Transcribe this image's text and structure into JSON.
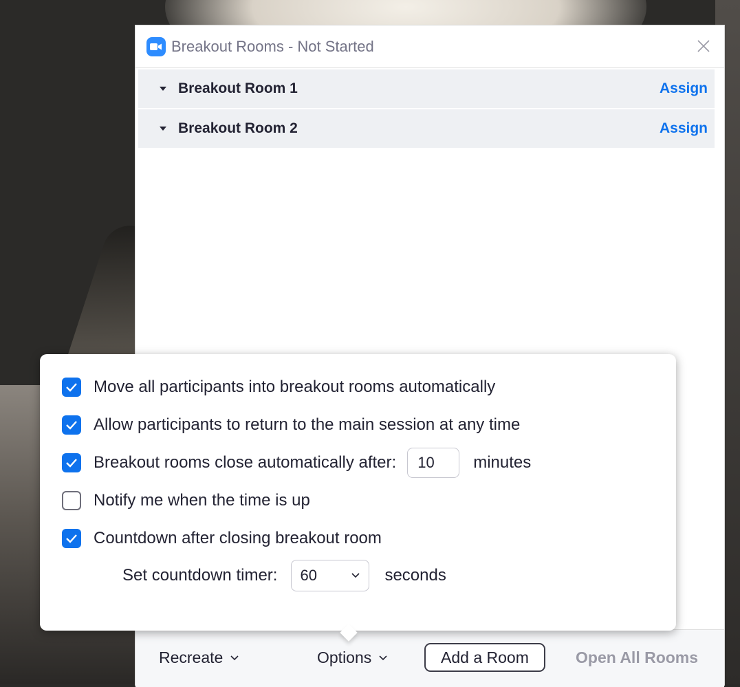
{
  "window": {
    "title": "Breakout Rooms - Not Started"
  },
  "rooms": [
    {
      "name": "Breakout Room 1",
      "action": "Assign"
    },
    {
      "name": "Breakout Room 2",
      "action": "Assign"
    }
  ],
  "options": {
    "move_auto": {
      "label": "Move all participants into breakout rooms automatically",
      "checked": true
    },
    "allow_return": {
      "label": "Allow participants to return to the main session at any time",
      "checked": true
    },
    "close_auto": {
      "label": "Breakout rooms close automatically after:",
      "value": "10",
      "unit": "minutes",
      "checked": true
    },
    "notify": {
      "label": "Notify me when the time is up",
      "checked": false
    },
    "countdown": {
      "label": "Countdown after closing breakout room",
      "checked": true
    },
    "timer": {
      "label": "Set countdown timer:",
      "value": "60",
      "unit": "seconds"
    }
  },
  "bottombar": {
    "recreate": "Recreate",
    "options": "Options",
    "add_room": "Add a Room",
    "open_all": "Open All Rooms"
  },
  "colors": {
    "accent": "#0e72ed",
    "zoom_brand": "#2d8cff",
    "row_bg": "#eef0f3",
    "disabled_text": "#9a9aa6"
  },
  "icons": {
    "app": "zoom-camera-icon",
    "close": "close-icon",
    "expand": "caret-down-icon",
    "check": "checkmark-icon",
    "dropdown": "chevron-down-icon"
  }
}
